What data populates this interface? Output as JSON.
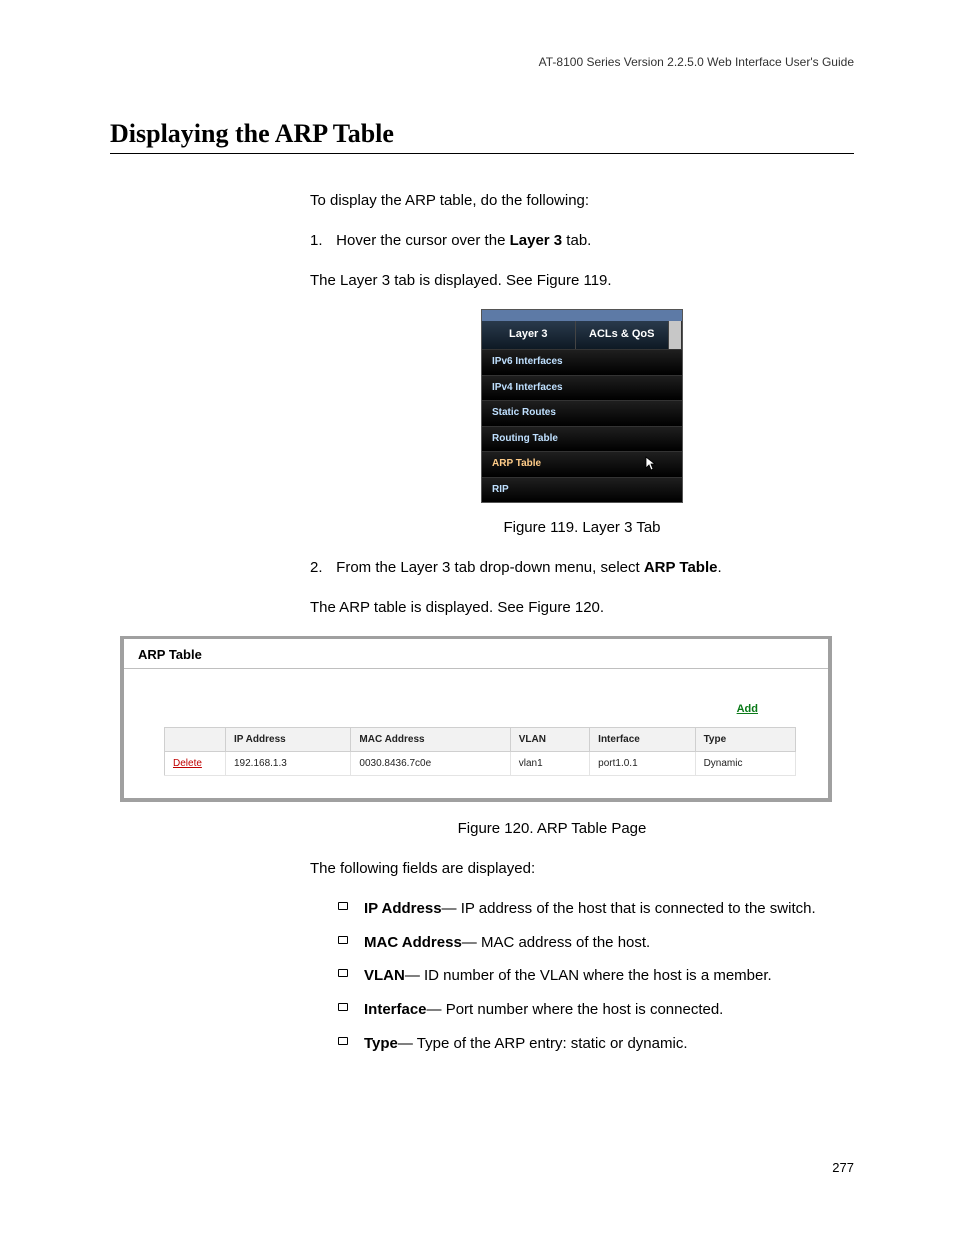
{
  "header": {
    "running_head": "AT-8100 Series Version 2.2.5.0 Web Interface User's Guide"
  },
  "section": {
    "title": "Displaying the ARP Table",
    "intro": "To display the ARP table, do the following:",
    "step1_num": "1.",
    "step1_pre": "Hover the cursor over the ",
    "step1_bold": "Layer 3",
    "step1_post": " tab.",
    "step1_follow": "The Layer 3 tab is displayed. See Figure 119.",
    "step2_num": "2.",
    "step2_pre": "From the Layer 3 tab drop-down menu, select ",
    "step2_bold": "ARP Table",
    "step2_post": ".",
    "step2_follow": "The ARP table is displayed. See Figure 120.",
    "fields_intro": "The following fields are displayed:"
  },
  "fig119": {
    "tab_active": "Layer 3",
    "tab_next": "ACLs & QoS",
    "items": {
      "ipv6": "IPv6 Interfaces",
      "ipv4": "IPv4 Interfaces",
      "static": "Static Routes",
      "routing": "Routing Table",
      "arp": "ARP Table",
      "rip": "RIP"
    },
    "caption": "Figure 119. Layer 3 Tab"
  },
  "fig120": {
    "panel_title": "ARP Table",
    "add_label": "Add",
    "columns": {
      "ip": "IP Address",
      "mac": "MAC Address",
      "vlan": "VLAN",
      "iface": "Interface",
      "type": "Type"
    },
    "row": {
      "delete_label": "Delete",
      "ip": "192.168.1.3",
      "mac": "0030.8436.7c0e",
      "vlan": "vlan1",
      "iface": "port1.0.1",
      "type": "Dynamic"
    },
    "caption": "Figure 120. ARP Table Page"
  },
  "fields": {
    "ip_label": "IP Address",
    "ip_desc": "— IP address of the host that is connected to the switch.",
    "mac_label": "MAC Address",
    "mac_desc": "— MAC address of the host.",
    "vlan_label": "VLAN",
    "vlan_desc": "— ID number of the VLAN where the host is a member.",
    "iface_label": "Interface",
    "iface_desc": "— Port number where the host is connected.",
    "type_label": "Type",
    "type_desc": "— Type of the ARP entry: static or dynamic."
  },
  "page_number": "277"
}
